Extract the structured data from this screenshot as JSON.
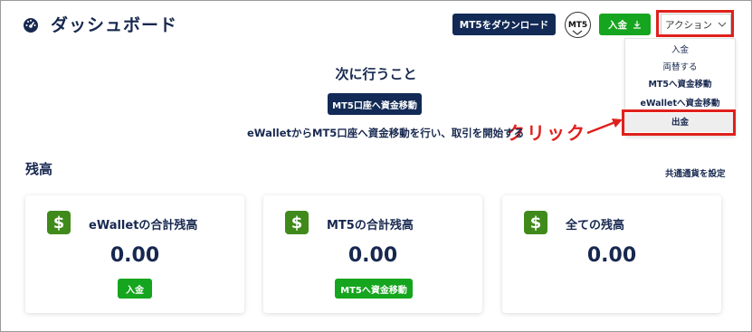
{
  "header": {
    "title": "ダッシュボード",
    "mt5_download_label": "MT5をダウンロード",
    "mt5_badge": "MT5",
    "deposit_label": "入金",
    "action_label": "アクション"
  },
  "dropdown": {
    "items": [
      "入金",
      "両替する",
      "MT5へ資金移動",
      "eWalletへ資金移動",
      "出金"
    ]
  },
  "annotation": {
    "click_label": "クリック"
  },
  "main": {
    "next_title": "次に行うこと",
    "transfer_button": "MT5口座へ資金移動",
    "hint": "eWalletからMT5口座へ資金移動を行い、取引を開始する",
    "balance_title": "残高",
    "currency_link": "共通通貨を設定"
  },
  "cards": [
    {
      "label": "eWalletの合計残高",
      "value": "0.00",
      "button": "入金"
    },
    {
      "label": "MT5の合計残高",
      "value": "0.00",
      "button": "MT5へ資金移動"
    },
    {
      "label": "全ての残高",
      "value": "0.00"
    }
  ],
  "colors": {
    "navy": "#122a55",
    "green": "#15a51e",
    "highlight_red": "#e0201c",
    "card_icon_green": "#3f8a1b"
  },
  "icons": {
    "logo": "speedometer-icon",
    "deposit": "download-icon",
    "action": "chevron-down-icon",
    "card": "dollar-icon"
  }
}
